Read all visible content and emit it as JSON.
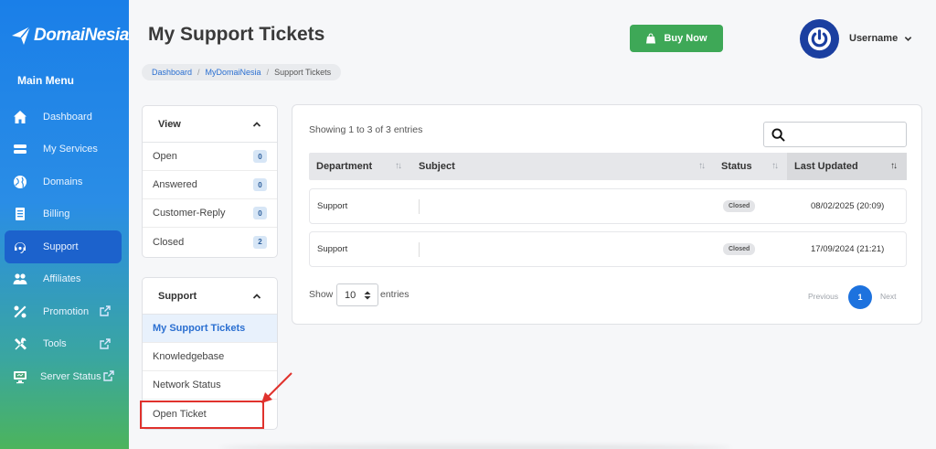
{
  "brand": {
    "name": "DomaiNesia"
  },
  "sidebar": {
    "title": "Main Menu",
    "items": [
      {
        "label": "Dashboard",
        "icon": "home-icon",
        "active": false,
        "external": false
      },
      {
        "label": "My Services",
        "icon": "server-stack-icon",
        "active": false,
        "external": false
      },
      {
        "label": "Domains",
        "icon": "globe-icon",
        "active": false,
        "external": false
      },
      {
        "label": "Billing",
        "icon": "invoice-icon",
        "active": false,
        "external": false
      },
      {
        "label": "Support",
        "icon": "headset-icon",
        "active": true,
        "external": false
      },
      {
        "label": "Affiliates",
        "icon": "users-icon",
        "active": false,
        "external": false
      },
      {
        "label": "Promotion",
        "icon": "percent-icon",
        "active": false,
        "external": true
      },
      {
        "label": "Tools",
        "icon": "tools-icon",
        "active": false,
        "external": true
      },
      {
        "label": "Server Status",
        "icon": "monitor-icon",
        "active": false,
        "external": true
      }
    ]
  },
  "header": {
    "title": "My Support Tickets",
    "buy_now": "Buy Now",
    "username": "Username"
  },
  "breadcrumb": {
    "items": [
      "Dashboard",
      "MyDomaiNesia"
    ],
    "current": "Support Tickets"
  },
  "view_panel": {
    "title": "View",
    "rows": [
      {
        "label": "Open",
        "count": "0"
      },
      {
        "label": "Answered",
        "count": "0"
      },
      {
        "label": "Customer-Reply",
        "count": "0"
      },
      {
        "label": "Closed",
        "count": "2"
      }
    ]
  },
  "support_panel": {
    "title": "Support",
    "rows": [
      "My Support Tickets",
      "Knowledgebase",
      "Network Status",
      "Open Ticket"
    ]
  },
  "table": {
    "showing": "Showing 1 to 3 of 3 entries",
    "search_placeholder": "",
    "columns": [
      "Department",
      "Subject",
      "Status",
      "Last Updated"
    ],
    "rows": [
      {
        "department": "Support",
        "subject": "",
        "status": "Closed",
        "updated": "08/02/2025 (20:09)"
      },
      {
        "department": "Support",
        "subject": "",
        "status": "Closed",
        "updated": "17/09/2024 (21:21)"
      }
    ],
    "show_label": "Show",
    "page_size": "10",
    "entries_label": "entries",
    "pagination": {
      "previous": "Previous",
      "current": "1",
      "next": "Next"
    }
  },
  "colors": {
    "sidebar_top": "#1a7fe8",
    "sidebar_bottom": "#4cb45c",
    "buy_button": "#3ea857",
    "accent": "#1d72de",
    "highlight": "#e0322d"
  }
}
